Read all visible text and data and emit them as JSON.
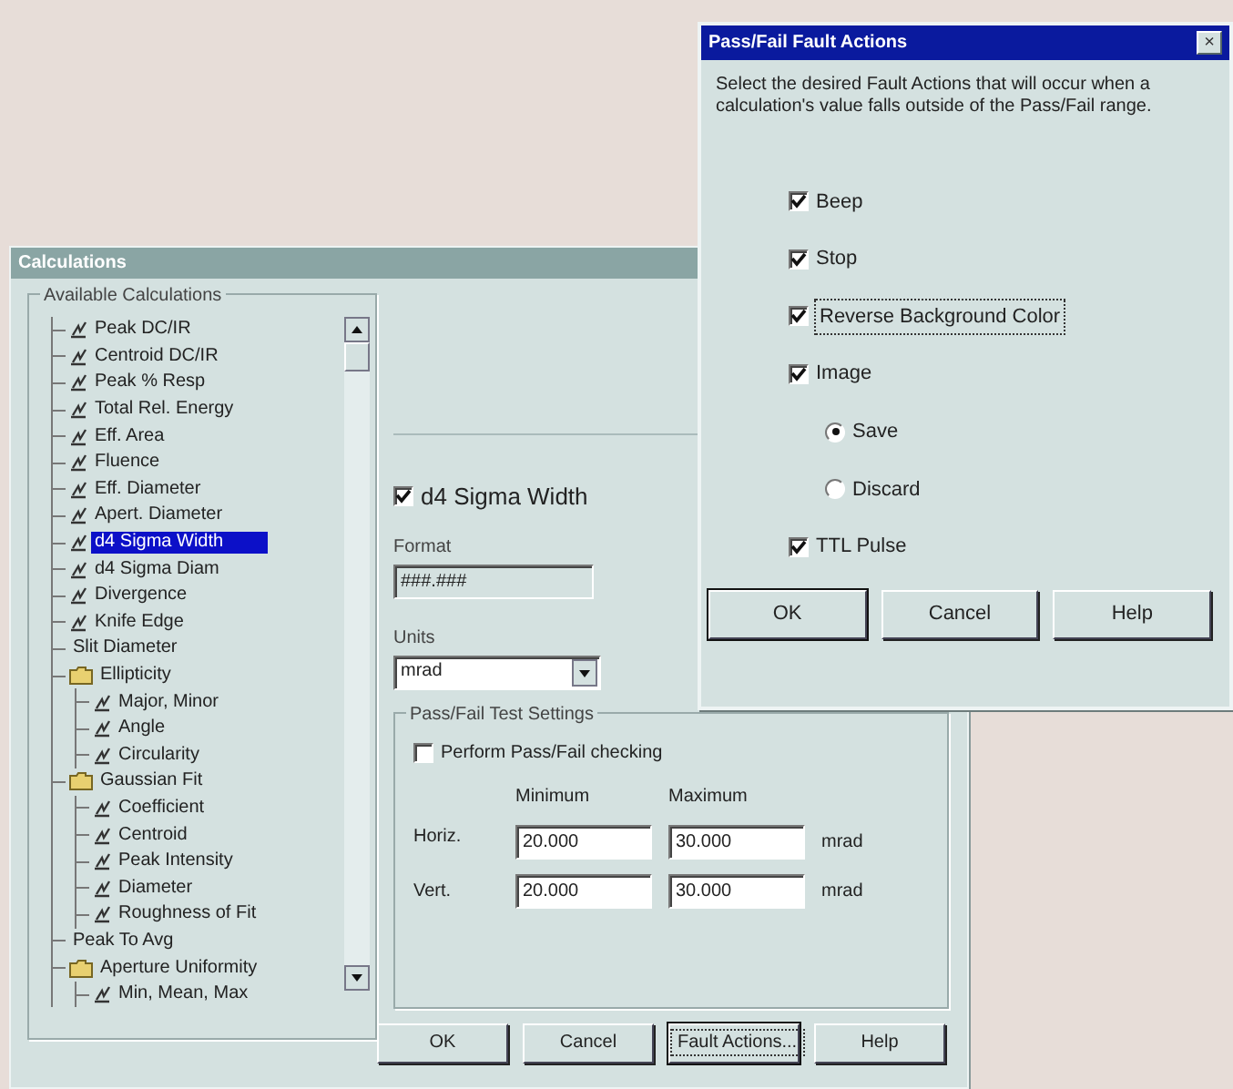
{
  "main_window": {
    "title": "Calculations",
    "tree": {
      "label": "Available Calculations",
      "items": [
        {
          "label": "Peak DC/IR",
          "kind": "calc",
          "selected": false
        },
        {
          "label": "Centroid DC/IR",
          "kind": "calc",
          "selected": false
        },
        {
          "label": "Peak % Resp",
          "kind": "calc",
          "selected": false
        },
        {
          "label": "Total Rel. Energy",
          "kind": "calc",
          "selected": false
        },
        {
          "label": "Eff. Area",
          "kind": "calc",
          "selected": false
        },
        {
          "label": "Fluence",
          "kind": "calc",
          "selected": false
        },
        {
          "label": "Eff. Diameter",
          "kind": "calc",
          "selected": false
        },
        {
          "label": "Apert. Diameter",
          "kind": "calc",
          "selected": false
        },
        {
          "label": "d4 Sigma Width",
          "kind": "calc",
          "selected": true
        },
        {
          "label": "d4 Sigma Diam",
          "kind": "calc",
          "selected": false
        },
        {
          "label": "Divergence",
          "kind": "calc",
          "selected": false
        },
        {
          "label": "Knife Edge",
          "kind": "calc",
          "selected": false
        },
        {
          "label": "Slit Diameter",
          "kind": "plain",
          "selected": false
        },
        {
          "label": "Ellipticity",
          "kind": "folder",
          "selected": false,
          "children": [
            {
              "label": "Major, Minor",
              "kind": "calc",
              "selected": false
            },
            {
              "label": "Angle",
              "kind": "calc",
              "selected": false
            },
            {
              "label": "Circularity",
              "kind": "calc",
              "selected": false
            }
          ]
        },
        {
          "label": "Gaussian Fit",
          "kind": "folder",
          "selected": false,
          "children": [
            {
              "label": "Coefficient",
              "kind": "calc",
              "selected": false
            },
            {
              "label": "Centroid",
              "kind": "calc",
              "selected": false
            },
            {
              "label": "Peak Intensity",
              "kind": "calc",
              "selected": false
            },
            {
              "label": "Diameter",
              "kind": "calc",
              "selected": false
            },
            {
              "label": "Roughness of Fit",
              "kind": "calc",
              "selected": false
            }
          ]
        },
        {
          "label": "Peak To Avg",
          "kind": "plain",
          "selected": false
        },
        {
          "label": "Aperture Uniformity",
          "kind": "folder",
          "selected": false,
          "children": [
            {
              "label": "Min, Mean, Max",
              "kind": "calc",
              "selected": false
            }
          ]
        }
      ]
    },
    "calculation": {
      "label": "d4 Sigma Width",
      "checked": true
    },
    "format": {
      "label": "Format",
      "value": "###.###"
    },
    "units": {
      "label": "Units",
      "value": "mrad"
    },
    "pass_fail": {
      "label": "Pass/Fail Test Settings",
      "perform": {
        "label": "Perform Pass/Fail checking",
        "checked": false
      },
      "columns": [
        "Minimum",
        "Maximum"
      ],
      "rows": [
        {
          "label": "Horiz.",
          "minimum": "20.000",
          "maximum": "30.000",
          "unit": "mrad"
        },
        {
          "label": "Vert.",
          "minimum": "20.000",
          "maximum": "30.000",
          "unit": "mrad"
        }
      ]
    },
    "buttons": [
      {
        "label": "OK",
        "default": false
      },
      {
        "label": "Cancel",
        "default": false
      },
      {
        "label": "Fault Actions...",
        "default": true
      },
      {
        "label": "Help",
        "default": false
      }
    ]
  },
  "fault_dialog": {
    "title": "Pass/Fail Fault Actions",
    "close": "×",
    "description": "Select the desired Fault Actions that will occur when a calculation's value falls outside of the Pass/Fail range.",
    "options": [
      {
        "kind": "checkbox",
        "label": "Beep",
        "checked": true,
        "focused": false
      },
      {
        "kind": "checkbox",
        "label": "Stop",
        "checked": true,
        "focused": false
      },
      {
        "kind": "checkbox",
        "label": "Reverse Background Color",
        "checked": true,
        "focused": true
      },
      {
        "kind": "checkbox",
        "label": "Image",
        "checked": true,
        "focused": false
      },
      {
        "kind": "radio",
        "label": "Save",
        "checked": true,
        "focused": false
      },
      {
        "kind": "radio",
        "label": "Discard",
        "checked": false,
        "focused": false
      },
      {
        "kind": "checkbox",
        "label": "TTL Pulse",
        "checked": true,
        "focused": false
      }
    ],
    "buttons": [
      {
        "label": "OK",
        "default": true
      },
      {
        "label": "Cancel",
        "default": false
      },
      {
        "label": "Help",
        "default": false
      }
    ]
  }
}
